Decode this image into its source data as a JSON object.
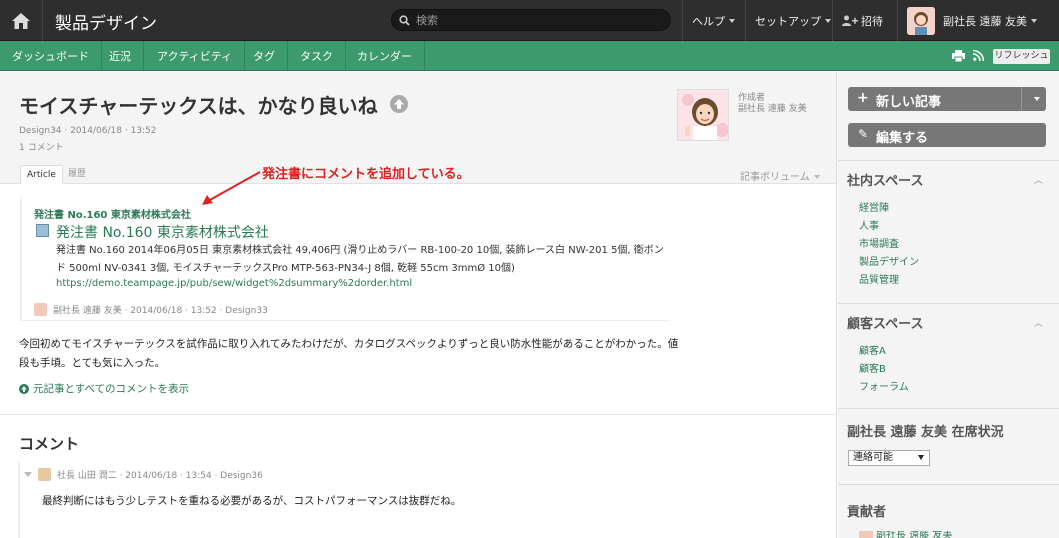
{
  "topbar": {
    "space_title": "製品デザイン",
    "search_placeholder": "検索",
    "help": "ヘルプ",
    "setup": "セットアップ",
    "invite": "招待",
    "user_name": "副社長 遠藤 友美"
  },
  "nav": {
    "tabs": [
      "ダッシュボード",
      "近況",
      "アクティビティ",
      "タグ",
      "タスク",
      "カレンダー"
    ],
    "refresh": "リフレッシュ"
  },
  "post": {
    "title": "モイスチャーテックスは、かなり良いね",
    "meta": "Design34 · 2014/06/18 · 13:52",
    "comment_count": "1 コメント",
    "tab_article": "Article",
    "tab_history": "履歴",
    "author_label": "作成者",
    "author_name": "副社長 遠藤 友美",
    "volume": "記事ボリューム",
    "annotation": "発注書にコメントを追加している。",
    "embed": {
      "heading": "発注書 No.160 東京素材株式会社",
      "title": "発注書 No.160 東京素材株式会社",
      "desc": "発注書 No.160 2014年06月05日 東京素材株式会社 49,406円 (滑り止めラバー RB-100-20 10個, 装飾レース白 NW-201 5個, 衛ボンド 500ml NV-0341 3個, モイスチャーテックスPro MTP-563-PN34-J 8個, 乾軽 55cm 3mmØ 10個)",
      "link": "https://demo.teampage.jp/pub/sew/widget%2dsummary%2dorder.html",
      "meta": "副社長 遠藤 友美 · 2014/06/18 · 13:52 · Design33"
    },
    "body": "今回初めてモイスチャーテックスを試作品に取り入れてみたわけだが、カタログスペックよりずっと良い防水性能があることがわかった。値段も手頃。とても気に入った。",
    "show_all": "元記事とすべてのコメントを表示"
  },
  "comments": {
    "heading": "コメント",
    "items": [
      {
        "meta": "社長 山田 潤二 · 2014/06/18 · 13:54 · Design36",
        "text": "最終判断にはもう少しテストを重ねる必要があるが、コストパフォーマンスは抜群だね。"
      }
    ]
  },
  "sidebar": {
    "new_post": "新しい記事",
    "edit": "編集する",
    "internal_heading": "社内スペース",
    "internal_links": [
      "経営陣",
      "人事",
      "市場調査",
      "製品デザイン",
      "品質管理"
    ],
    "customer_heading": "顧客スペース",
    "customer_links": [
      "顧客A",
      "顧客B",
      "フォーラム"
    ],
    "presence_heading": "副社長 遠藤 友美 在席状況",
    "presence_value": "連絡可能",
    "contributors_heading": "貢献者",
    "contributor_partial": "副社長 遠藤 友美"
  },
  "colors": {
    "topbar": "#2e2e2e",
    "accent_green": "#3c9a6c",
    "link_green": "#2c7a54",
    "annotation_red": "#e02020"
  }
}
